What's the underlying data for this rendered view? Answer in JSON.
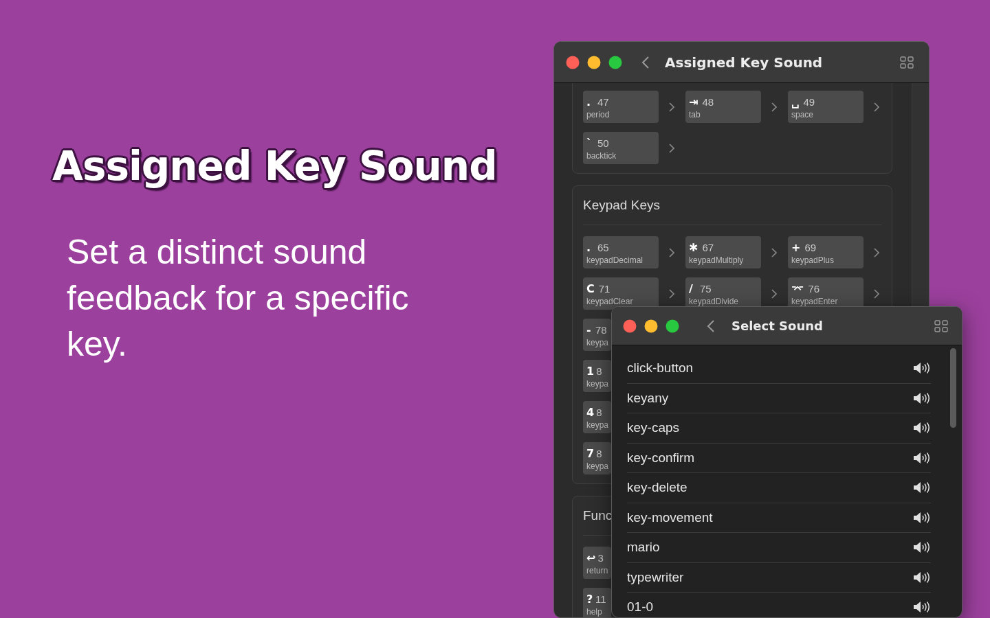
{
  "headline": "Assigned Key Sound",
  "tagline": "Set a distinct sound feedback for a specific key.",
  "key_window": {
    "title": "Assigned Key Sound",
    "sections": [
      {
        "keys": [
          {
            "symbol": ".",
            "code": "47",
            "name": "period",
            "cut": false
          },
          {
            "symbol": "⇥",
            "code": "48",
            "name": "tab",
            "cut": false
          },
          {
            "symbol": "␣",
            "code": "49",
            "name": "space",
            "cut": false
          },
          {
            "symbol": "`",
            "code": "50",
            "name": "backtick",
            "cut": false
          }
        ]
      },
      {
        "heading": "Keypad Keys",
        "keys": [
          {
            "symbol": ".",
            "code": "65",
            "name": "keypadDecimal",
            "cut": false
          },
          {
            "symbol": "✱",
            "code": "67",
            "name": "keypadMultiply",
            "cut": false
          },
          {
            "symbol": "+",
            "code": "69",
            "name": "keypadPlus",
            "cut": false
          },
          {
            "symbol": "C",
            "code": "71",
            "name": "keypadClear",
            "cut": false
          },
          {
            "symbol": "/",
            "code": "75",
            "name": "keypadDivide",
            "cut": false
          },
          {
            "symbol": "⌤",
            "code": "76",
            "name": "keypadEnter",
            "cut": false
          },
          {
            "symbol": "-",
            "code": "78",
            "name": "keypa",
            "cut": true
          },
          {
            "symbol": "1",
            "code": "8",
            "name": "keypa",
            "cut": true
          },
          {
            "symbol": "4",
            "code": "8",
            "name": "keypa",
            "cut": true
          },
          {
            "symbol": "7",
            "code": "8",
            "name": "keypa",
            "cut": true
          }
        ]
      },
      {
        "heading": "Func",
        "keys": [
          {
            "symbol": "↩",
            "code": "3",
            "name": "return",
            "cut": true
          },
          {
            "symbol": "?",
            "code": "11",
            "name": "help",
            "cut": true
          }
        ]
      }
    ]
  },
  "sound_window": {
    "title": "Select Sound",
    "sounds": [
      "click-button",
      "keyany",
      "key-caps",
      "key-confirm",
      "key-delete",
      "key-movement",
      "mario",
      "typewriter",
      "01-0"
    ]
  }
}
